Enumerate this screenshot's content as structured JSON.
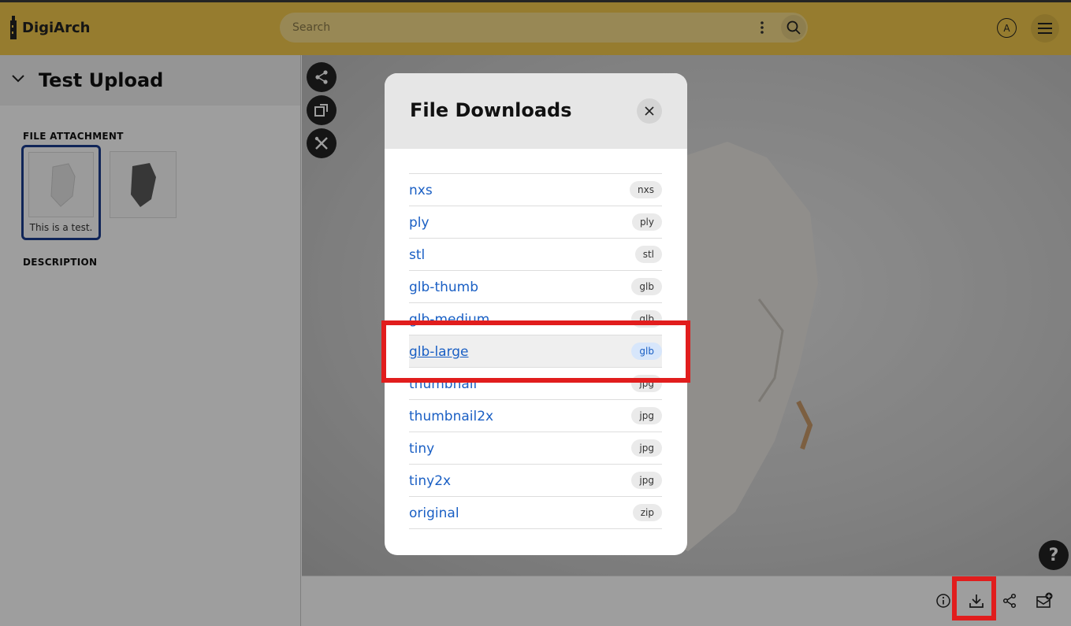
{
  "header": {
    "brand": "DigiArch",
    "search_placeholder": "Search",
    "avatar_initial": "A"
  },
  "sidebar": {
    "title": "Test Upload",
    "file_attachment_label": "FILE ATTACHMENT",
    "thumb_caption": "This is a test.",
    "description_label": "DESCRIPTION"
  },
  "modal": {
    "title": "File Downloads",
    "files": [
      {
        "name": "nxs",
        "type": "nxs"
      },
      {
        "name": "ply",
        "type": "ply"
      },
      {
        "name": "stl",
        "type": "stl"
      },
      {
        "name": "glb-thumb",
        "type": "glb"
      },
      {
        "name": "glb-medium",
        "type": "glb"
      },
      {
        "name": "glb-large",
        "type": "glb"
      },
      {
        "name": "thumbnail",
        "type": "jpg"
      },
      {
        "name": "thumbnail2x",
        "type": "jpg"
      },
      {
        "name": "tiny",
        "type": "jpg"
      },
      {
        "name": "tiny2x",
        "type": "jpg"
      },
      {
        "name": "original",
        "type": "zip"
      }
    ]
  },
  "help": {
    "label": "?"
  },
  "colors": {
    "header": "#f2c94c",
    "link": "#1a5fc4",
    "highlight": "#e11d1d",
    "selected_border": "#1a3d8f"
  }
}
